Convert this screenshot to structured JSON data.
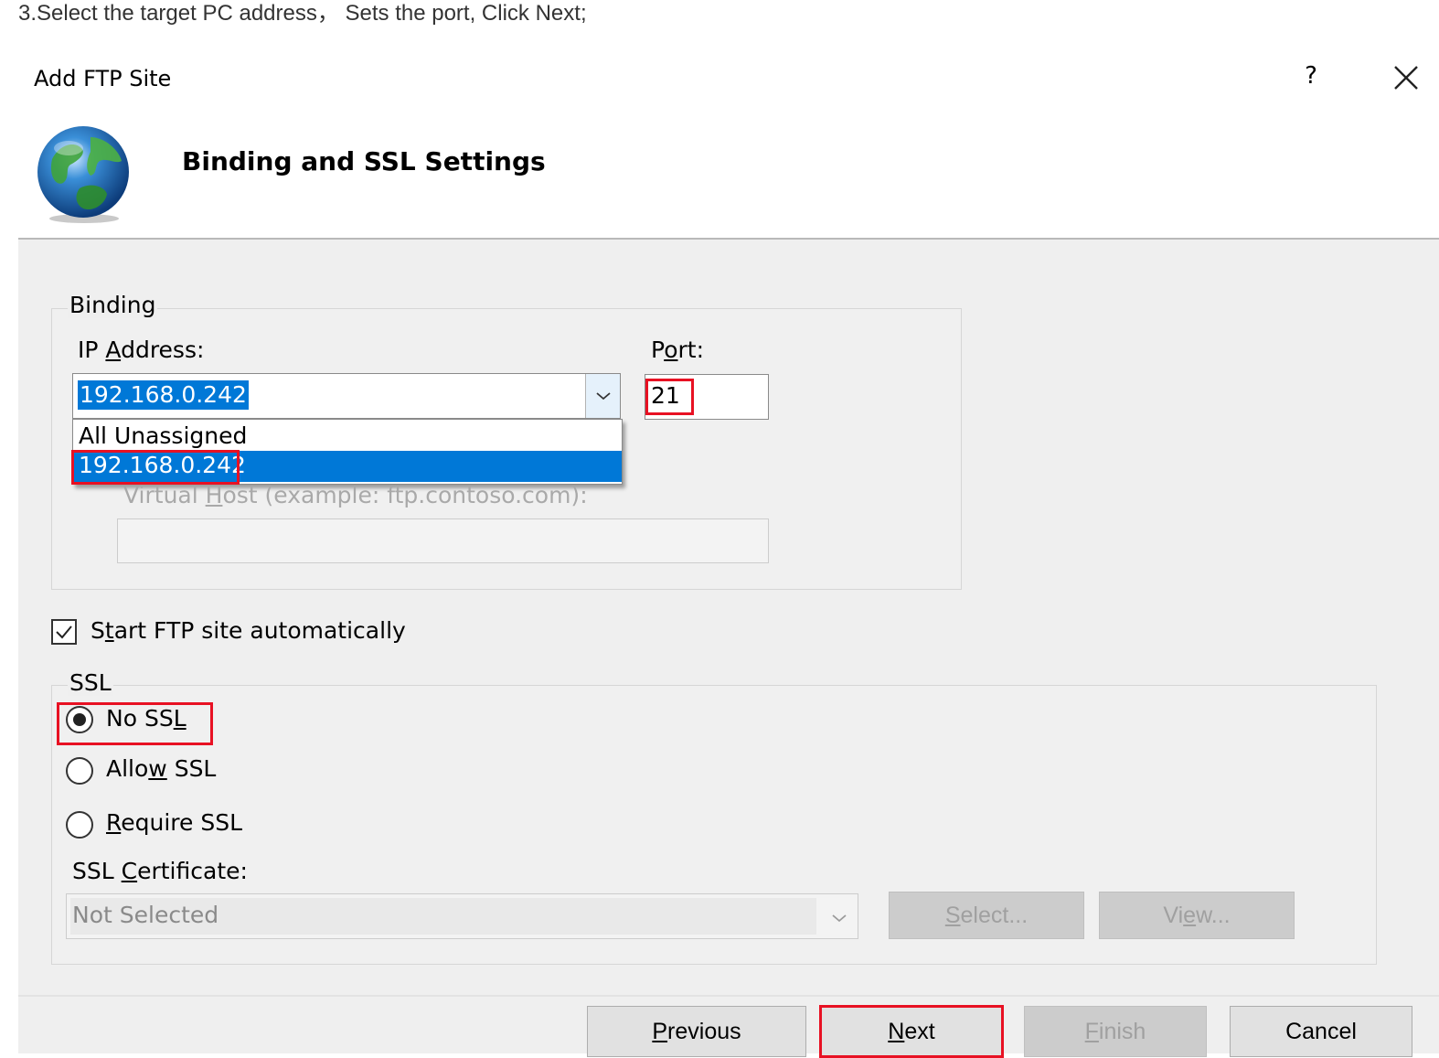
{
  "caption": "3.Select the target PC address， Sets the port, Click Next;",
  "dialog": {
    "title": "Add FTP Site",
    "help_label": "?",
    "header_title": "Binding and SSL Settings"
  },
  "binding": {
    "legend": "Binding",
    "ip_label_pre": "IP ",
    "ip_label_key": "A",
    "ip_label_post": "ddress:",
    "ip_value": "192.168.0.242",
    "ip_options": [
      "All Unassigned",
      "192.168.0.242"
    ],
    "port_label_pre": "P",
    "port_label_key": "o",
    "port_label_post": "rt:",
    "port_value": "21",
    "virtual_host_pre": "Virtual ",
    "virtual_host_key": "H",
    "virtual_host_post": "ost (example: ftp.contoso.com):",
    "virtual_host_value": ""
  },
  "start_auto": {
    "label_pre": "S",
    "label_key": "t",
    "label_post": "art FTP site automatically",
    "checked": true
  },
  "ssl": {
    "legend": "SSL",
    "no_ssl_pre": "No SS",
    "no_ssl_key": "L",
    "no_ssl_post": "",
    "allow_ssl_pre": "Allo",
    "allow_ssl_key": "w",
    "allow_ssl_post": " SSL",
    "require_ssl_pre": "",
    "require_ssl_key": "R",
    "require_ssl_post": "equire SSL",
    "selected": "No SSL",
    "cert_label_pre": "SSL ",
    "cert_label_key": "C",
    "cert_label_post": "ertificate:",
    "cert_value": "Not Selected",
    "select_pre": "",
    "select_key": "S",
    "select_post": "elect...",
    "view_pre": "Vi",
    "view_key": "e",
    "view_post": "w..."
  },
  "footer": {
    "previous_key": "P",
    "previous_post": "revious",
    "next_key": "N",
    "next_post": "ext",
    "finish_key": "F",
    "finish_post": "inish",
    "cancel_label": "Cancel"
  },
  "colors": {
    "highlight": "#0078d7",
    "annotation": "#e81123",
    "panel": "#efefef"
  }
}
